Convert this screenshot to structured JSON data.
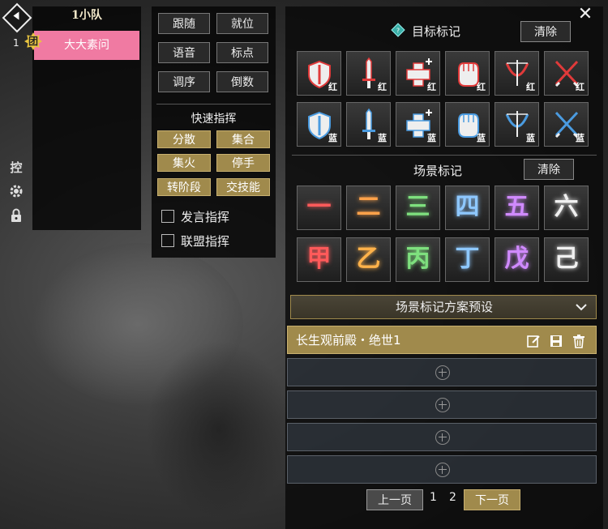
{
  "team": {
    "title": "1小队",
    "member_index": "1",
    "leader_badge": "团",
    "member_name": "大大素问"
  },
  "side_icons": {
    "control_label": "控"
  },
  "commands": {
    "buttons": [
      "跟随",
      "就位",
      "语音",
      "标点",
      "调序",
      "倒数"
    ],
    "quick_title": "快速指挥",
    "quick_buttons": [
      "分散",
      "集合",
      "集火",
      "停手",
      "转阶段",
      "交技能"
    ],
    "checkboxes": [
      "发言指挥",
      "联盟指挥"
    ]
  },
  "target_marks": {
    "title": "目标标记",
    "clear_label": "清除",
    "red_suffix": "红",
    "blue_suffix": "蓝",
    "red_color": "#e03a3a",
    "blue_color": "#4a9be0",
    "icons": [
      "shield-icon",
      "sword-icon",
      "heal-plus-icon",
      "fist-icon",
      "bow-icon",
      "crossed-swords-icon"
    ]
  },
  "scene_marks": {
    "title": "场景标记",
    "clear_label": "清除",
    "row1": [
      {
        "char": "一",
        "color": "#ff5a5a"
      },
      {
        "char": "二",
        "color": "#ffa24a"
      },
      {
        "char": "三",
        "color": "#7ee07e"
      },
      {
        "char": "四",
        "color": "#8ec8ff"
      },
      {
        "char": "五",
        "color": "#d08aff"
      },
      {
        "char": "六",
        "color": "#f0f0f0"
      }
    ],
    "row2": [
      {
        "char": "甲",
        "color": "#ff5a5a"
      },
      {
        "char": "乙",
        "color": "#ffb24a"
      },
      {
        "char": "丙",
        "color": "#7ee07e"
      },
      {
        "char": "丁",
        "color": "#8ec8ff"
      },
      {
        "char": "戊",
        "color": "#d08aff"
      },
      {
        "char": "己",
        "color": "#f0f0f0"
      }
    ]
  },
  "presets": {
    "header": "场景标记方案预设",
    "active_name": "长生观前殿・绝世1",
    "empty_slots": 4
  },
  "pagination": {
    "prev_label": "上一页",
    "next_label": "下一页",
    "pages": [
      "1",
      "2"
    ],
    "current": "2"
  }
}
